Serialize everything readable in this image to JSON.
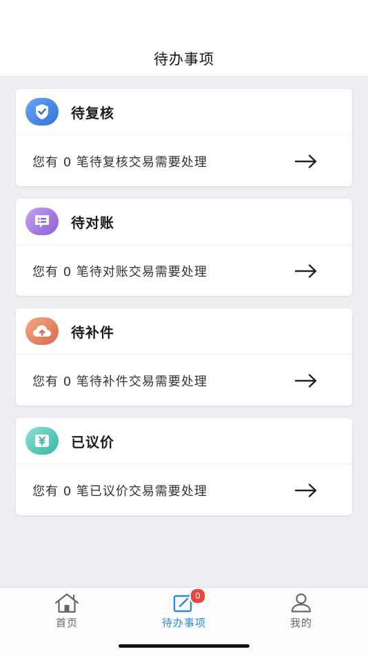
{
  "header": {
    "title": "待办事项"
  },
  "cards": [
    {
      "title": "待复核",
      "message": "您有 0 笔待复核交易需要处理",
      "icon": "shield-check-icon",
      "gradient": [
        "#6aa4f2",
        "#2f74dc"
      ]
    },
    {
      "title": "待对账",
      "message": "您有 0 笔待对账交易需要处理",
      "icon": "list-chat-icon",
      "gradient": [
        "#c4a2ee",
        "#8a5fd9"
      ]
    },
    {
      "title": "待补件",
      "message": "您有 0 笔待补件交易需要处理",
      "icon": "cloud-upload-icon",
      "gradient": [
        "#f1a97f",
        "#dd6a4d"
      ]
    },
    {
      "title": "已议价",
      "message": "您有 0 笔已议价交易需要处理",
      "icon": "yuan-card-icon",
      "gradient": [
        "#8fe0d4",
        "#34b6a5"
      ]
    }
  ],
  "tabbar": {
    "tabs": [
      {
        "label": "首页",
        "icon": "home-icon",
        "active": false
      },
      {
        "label": "待办事项",
        "icon": "todo-edit-icon",
        "active": true,
        "badge": "0"
      },
      {
        "label": "我的",
        "icon": "user-icon",
        "active": false
      }
    ],
    "active_color": "#2a8ad8",
    "inactive_color": "#666666"
  }
}
